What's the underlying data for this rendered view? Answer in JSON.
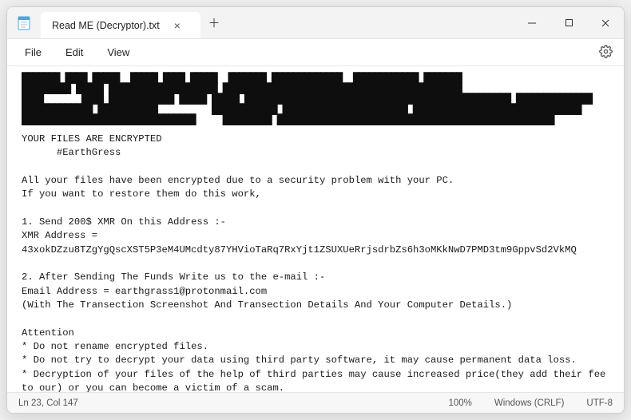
{
  "tab": {
    "title": "Read ME (Decryptor).txt",
    "close": "×"
  },
  "newTab": "＋",
  "winControls": {
    "min": "—",
    "max": "☐",
    "close": "✕"
  },
  "menu": {
    "file": "File",
    "edit": "Edit",
    "view": "View"
  },
  "blocks": "███████ ████ █████  █████ ████ █████  ███████ █████████████  ████████████ ███████\n█████████ █████ ████████████████████ ████████████████████████████████████████████\n████       ████ ████████████ █████ █████ █████████████████████████████████████████████████ ██████████████\n█████████████ ███████████          ████████████ ███████████████████████ ███████████████████████████████\n████████████████████████████████     █████████ ███████████████████████████████████████████████████",
  "body": {
    "l1": "YOUR FILES ARE ENCRYPTED",
    "l2": "      #EarthGress",
    "l3": "",
    "l4": "All your files have been encrypted due to a security problem with your PC.",
    "l5": "If you want to restore them do this work,",
    "l6": "",
    "l7": "1. Send 200$ XMR On this Address :-",
    "l8": "XMR Address = 43xokDZzu8TZgYgQscXST5P3eM4UMcdty87YHVioTaRq7RxYjt1ZSUXUeRrjsdrbZs6h3oMKkNwD7PMD3tm9GppvSd2VkMQ",
    "l9": "",
    "l10": "2. After Sending The Funds Write us to the e-mail :-",
    "l11": "Email Address = earthgrass1@protonmail.com",
    "l12": "(With The Transection Screenshot And Transection Details And Your Computer Details.)",
    "l13": "",
    "l14": "Attention",
    "l15": "* Do not rename encrypted files.",
    "l16": "* Do not try to decrypt your data using third party software, it may cause permanent data loss.",
    "l17": "* Decryption of your files of the help of third parties may cause increased price(they add their fee to our) or you can become a victim of a scam."
  },
  "status": {
    "pos": "Ln 23, Col 147",
    "zoom": "100%",
    "eol": "Windows (CRLF)",
    "enc": "UTF-8"
  }
}
